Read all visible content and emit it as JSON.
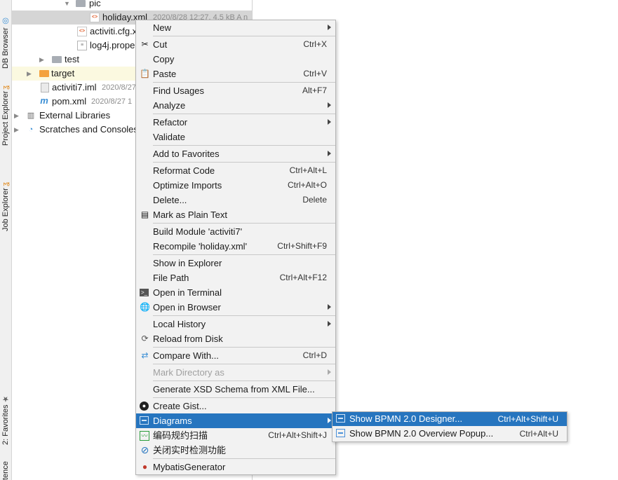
{
  "tool_strip": {
    "tabs": [
      {
        "label": "DB Browser",
        "icon": "db-browser-icon"
      },
      {
        "label": "Project Explorer",
        "icon": "project-explorer-icon"
      },
      {
        "label": "Job Explorer",
        "icon": "job-explorer-icon"
      },
      {
        "label": "2: Favorites",
        "icon": "star-icon"
      },
      {
        "label": "tence",
        "icon": ""
      }
    ]
  },
  "project_tree": {
    "items": [
      {
        "label": "pic",
        "icon": "folder-icon"
      },
      {
        "label": "holiday.xml",
        "meta": "2020/8/28 12:27, 4.5 kB A n",
        "icon": "xml-file-icon"
      },
      {
        "label": "activiti.cfg.x",
        "icon": "xml-file-icon"
      },
      {
        "label": "log4j.prope",
        "icon": "properties-file-icon"
      },
      {
        "label": "test",
        "icon": "folder-icon"
      },
      {
        "label": "target",
        "icon": "folder-orange-icon"
      },
      {
        "label": "activiti7.iml",
        "meta": "2020/8/27",
        "icon": "iml-file-icon"
      },
      {
        "label": "pom.xml",
        "meta": "2020/8/27 1",
        "icon": "maven-icon"
      },
      {
        "label": "External Libraries",
        "icon": "libraries-icon"
      },
      {
        "label": "Scratches and Consoles",
        "icon": "scratches-icon"
      }
    ]
  },
  "context_menu": {
    "items": [
      {
        "label": "New",
        "shortcut": "",
        "submenu": true
      },
      {
        "label": "Cut",
        "shortcut": "Ctrl+X",
        "icon": "scissors-icon"
      },
      {
        "label": "Copy",
        "shortcut": ""
      },
      {
        "label": "Paste",
        "shortcut": "Ctrl+V",
        "icon": "clipboard-icon"
      },
      {
        "label": "Find Usages",
        "shortcut": "Alt+F7"
      },
      {
        "label": "Analyze",
        "shortcut": "",
        "submenu": true
      },
      {
        "label": "Refactor",
        "shortcut": "",
        "submenu": true
      },
      {
        "label": "Validate",
        "shortcut": ""
      },
      {
        "label": "Add to Favorites",
        "shortcut": "",
        "submenu": true
      },
      {
        "label": "Reformat Code",
        "shortcut": "Ctrl+Alt+L"
      },
      {
        "label": "Optimize Imports",
        "shortcut": "Ctrl+Alt+O"
      },
      {
        "label": "Delete...",
        "shortcut": "Delete"
      },
      {
        "label": "Mark as Plain Text",
        "shortcut": "",
        "icon": "plain-text-icon"
      },
      {
        "label": "Build Module 'activiti7'",
        "shortcut": ""
      },
      {
        "label": "Recompile 'holiday.xml'",
        "shortcut": "Ctrl+Shift+F9"
      },
      {
        "label": "Show in Explorer",
        "shortcut": ""
      },
      {
        "label": "File Path",
        "shortcut": "Ctrl+Alt+F12"
      },
      {
        "label": "Open in Terminal",
        "shortcut": "",
        "icon": "terminal-icon"
      },
      {
        "label": "Open in Browser",
        "shortcut": "",
        "submenu": true,
        "icon": "globe-icon"
      },
      {
        "label": "Local History",
        "shortcut": "",
        "submenu": true
      },
      {
        "label": "Reload from Disk",
        "shortcut": "",
        "icon": "reload-icon"
      },
      {
        "label": "Compare With...",
        "shortcut": "Ctrl+D",
        "icon": "compare-icon"
      },
      {
        "label": "Mark Directory as",
        "shortcut": "",
        "submenu": true,
        "disabled": true
      },
      {
        "label": "Generate XSD Schema from XML File...",
        "shortcut": ""
      },
      {
        "label": "Create Gist...",
        "shortcut": "",
        "icon": "github-icon"
      },
      {
        "label": "Diagrams",
        "shortcut": "",
        "submenu": true,
        "active": true,
        "icon": "diagram-icon"
      },
      {
        "label": "编码规约扫描",
        "shortcut": "Ctrl+Alt+Shift+J",
        "icon": "scan-icon"
      },
      {
        "label": "关闭实时检测功能",
        "shortcut": "",
        "icon": "disable-icon"
      },
      {
        "label": "MybatisGenerator",
        "shortcut": "",
        "icon": "mybatis-icon"
      }
    ]
  },
  "diagrams_submenu": {
    "items": [
      {
        "label": "Show BPMN 2.0 Designer...",
        "shortcut": "Ctrl+Alt+Shift+U",
        "active": true
      },
      {
        "label": "Show BPMN 2.0 Overview Popup...",
        "shortcut": "Ctrl+Alt+U"
      }
    ]
  },
  "colors": {
    "selection": "#2675bf",
    "menu_background": "#f2f2f2",
    "tree_selected": "#d5d5d5"
  }
}
